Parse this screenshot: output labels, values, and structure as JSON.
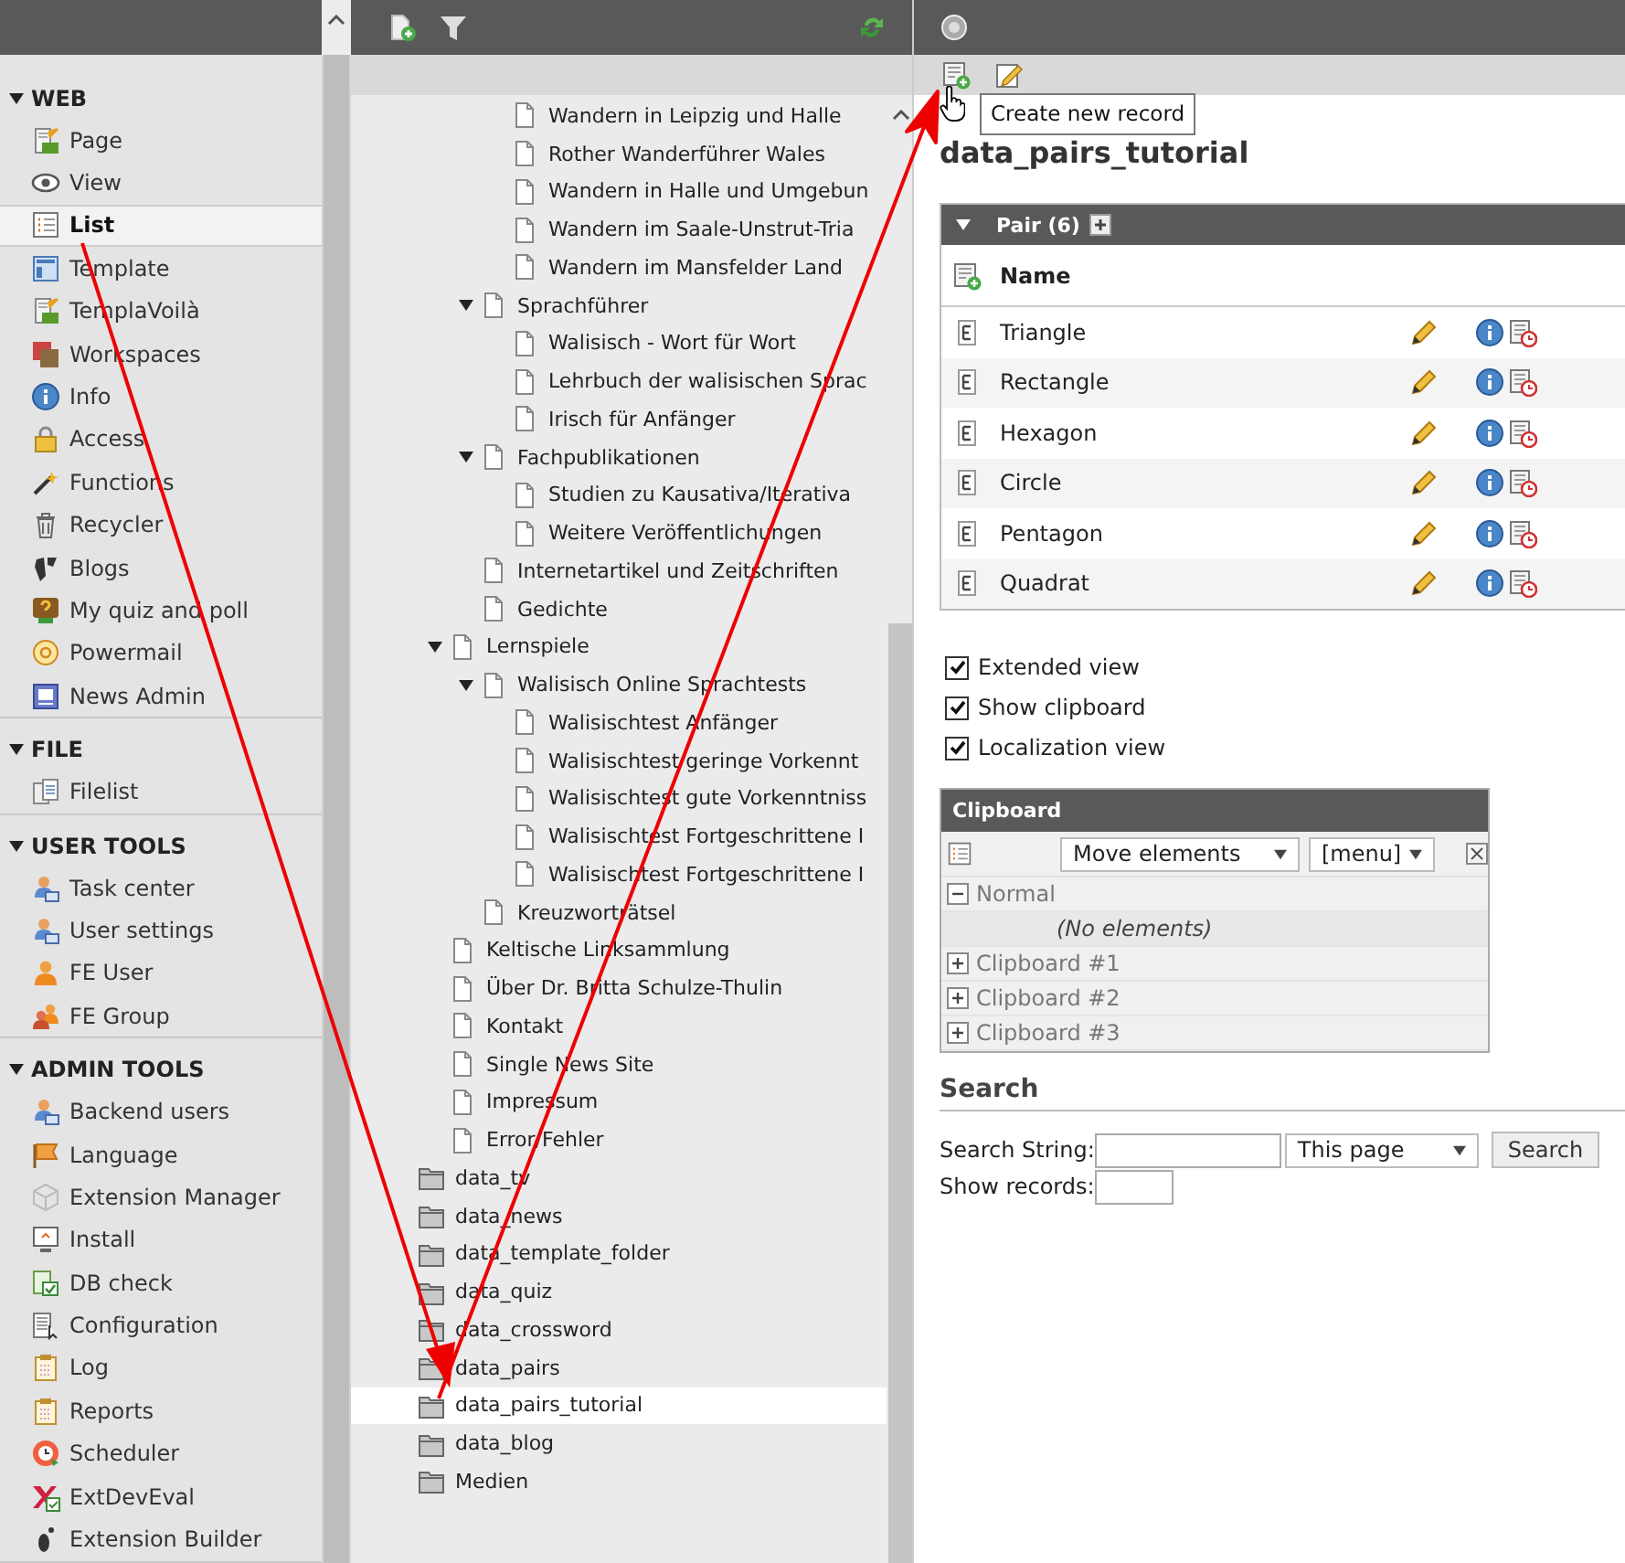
{
  "module_menu": {
    "groups": [
      {
        "title": "WEB",
        "expanded": true,
        "items": [
          {
            "label": "Page",
            "selected": false
          },
          {
            "label": "View",
            "selected": false
          },
          {
            "label": "List",
            "selected": true
          },
          {
            "label": "Template",
            "selected": false
          },
          {
            "label": "TemplaVoilà",
            "selected": false
          },
          {
            "label": "Workspaces",
            "selected": false
          },
          {
            "label": "Info",
            "selected": false
          },
          {
            "label": "Access",
            "selected": false
          },
          {
            "label": "Functions",
            "selected": false
          },
          {
            "label": "Recycler",
            "selected": false
          },
          {
            "label": "Blogs",
            "selected": false
          },
          {
            "label": "My quiz and poll",
            "selected": false
          },
          {
            "label": "Powermail",
            "selected": false
          },
          {
            "label": "News Admin",
            "selected": false
          }
        ]
      },
      {
        "title": "FILE",
        "expanded": true,
        "items": [
          {
            "label": "Filelist",
            "selected": false
          }
        ]
      },
      {
        "title": "USER TOOLS",
        "expanded": true,
        "items": [
          {
            "label": "Task center",
            "selected": false
          },
          {
            "label": "User settings",
            "selected": false
          },
          {
            "label": "FE User",
            "selected": false
          },
          {
            "label": "FE Group",
            "selected": false
          }
        ]
      },
      {
        "title": "ADMIN TOOLS",
        "expanded": true,
        "items": [
          {
            "label": "Backend users",
            "selected": false
          },
          {
            "label": "Language",
            "selected": false
          },
          {
            "label": "Extension Manager",
            "selected": false
          },
          {
            "label": "Install",
            "selected": false
          },
          {
            "label": "DB check",
            "selected": false
          },
          {
            "label": "Configuration",
            "selected": false
          },
          {
            "label": "Log",
            "selected": false
          },
          {
            "label": "Reports",
            "selected": false
          },
          {
            "label": "Scheduler",
            "selected": false
          },
          {
            "label": "ExtDevEval",
            "selected": false
          },
          {
            "label": "Extension Builder",
            "selected": false
          }
        ]
      }
    ]
  },
  "page_tree": {
    "items": [
      {
        "children": [
          {
            "children": [
              {
                "children": [
                  {
                    "label": "Wandern in Leipzig und Halle",
                    "kind": "page",
                    "expanded": false,
                    "selected": false
                  },
                  {
                    "label": "Rother Wanderführer Wales",
                    "kind": "page",
                    "expanded": false,
                    "selected": false
                  },
                  {
                    "label": "Wandern in Halle und Umgebun",
                    "kind": "page",
                    "expanded": false,
                    "selected": false
                  },
                  {
                    "label": "Wandern im Saale-Unstrut-Tria",
                    "kind": "page",
                    "expanded": false,
                    "selected": false
                  },
                  {
                    "label": "Wandern im Mansfelder Land",
                    "kind": "page",
                    "expanded": false,
                    "selected": false
                  }
                ]
              },
              {
                "label": "Sprachführer",
                "kind": "page",
                "expanded": true,
                "selected": false,
                "children": [
                  {
                    "label": "Walisisch - Wort für Wort",
                    "kind": "page",
                    "expanded": false,
                    "selected": false
                  },
                  {
                    "label": "Lehrbuch der walisischen Sprac",
                    "kind": "page",
                    "expanded": false,
                    "selected": false
                  },
                  {
                    "label": "Irisch für Anfänger",
                    "kind": "page",
                    "expanded": false,
                    "selected": false
                  }
                ]
              },
              {
                "label": "Fachpublikationen",
                "kind": "page",
                "expanded": true,
                "selected": false,
                "children": [
                  {
                    "label": "Studien zu Kausativa/Iterativa",
                    "kind": "page",
                    "expanded": false,
                    "selected": false
                  },
                  {
                    "label": "Weitere Veröffentlichungen",
                    "kind": "page",
                    "expanded": false,
                    "selected": false
                  }
                ]
              },
              {
                "label": "Internetartikel und Zeitschriften",
                "kind": "page",
                "expanded": false,
                "selected": false
              },
              {
                "label": "Gedichte",
                "kind": "page",
                "expanded": false,
                "selected": false
              }
            ]
          },
          {
            "label": "Lernspiele",
            "kind": "page",
            "expanded": true,
            "selected": false,
            "children": [
              {
                "label": "Walisisch Online Sprachtests",
                "kind": "page",
                "expanded": true,
                "selected": false,
                "children": [
                  {
                    "label": "Walisischtest Anfänger",
                    "kind": "page",
                    "expanded": false,
                    "selected": false
                  },
                  {
                    "label": "Walisischtest geringe Vorkennt",
                    "kind": "page",
                    "expanded": false,
                    "selected": false
                  },
                  {
                    "label": "Walisischtest gute Vorkenntniss",
                    "kind": "page",
                    "expanded": false,
                    "selected": false
                  },
                  {
                    "label": "Walisischtest Fortgeschrittene I",
                    "kind": "page",
                    "expanded": false,
                    "selected": false
                  },
                  {
                    "label": "Walisischtest Fortgeschrittene I",
                    "kind": "page",
                    "expanded": false,
                    "selected": false
                  }
                ]
              },
              {
                "label": "Kreuzworträtsel",
                "kind": "page",
                "expanded": false,
                "selected": false
              }
            ]
          },
          {
            "label": "Keltische Linksammlung",
            "kind": "page",
            "expanded": false,
            "selected": false
          },
          {
            "label": "Über Dr. Britta Schulze-Thulin",
            "kind": "page",
            "expanded": false,
            "selected": false
          },
          {
            "label": "Kontakt",
            "kind": "page",
            "expanded": false,
            "selected": false
          },
          {
            "label": "Single News Site",
            "kind": "page",
            "expanded": false,
            "selected": false
          },
          {
            "label": "Impressum",
            "kind": "page",
            "expanded": false,
            "selected": false
          },
          {
            "label": "Error/Fehler",
            "kind": "page",
            "expanded": false,
            "selected": false
          }
        ]
      },
      {
        "label": "data_tv",
        "kind": "folder",
        "expanded": false,
        "selected": false
      },
      {
        "label": "data_news",
        "kind": "folder",
        "expanded": false,
        "selected": false
      },
      {
        "label": "data_template_folder",
        "kind": "folder",
        "expanded": false,
        "selected": false
      },
      {
        "label": "data_quiz",
        "kind": "folder",
        "expanded": false,
        "selected": false
      },
      {
        "label": "data_crossword",
        "kind": "folder",
        "expanded": false,
        "selected": false
      },
      {
        "label": "data_pairs",
        "kind": "folder",
        "expanded": false,
        "selected": false
      },
      {
        "label": "data_pairs_tutorial",
        "kind": "folder",
        "expanded": false,
        "selected": true
      },
      {
        "label": "data_blog",
        "kind": "folder",
        "expanded": false,
        "selected": false
      },
      {
        "label": "Medien",
        "kind": "folder",
        "expanded": false,
        "selected": false
      }
    ]
  },
  "content": {
    "tooltip": "Create new record",
    "heading": "data_pairs_tutorial",
    "table": {
      "title": "Pair (6)",
      "expanded": true,
      "columns": [
        "Name"
      ],
      "rows": [
        {
          "name": "Triangle"
        },
        {
          "name": "Rectangle"
        },
        {
          "name": "Hexagon"
        },
        {
          "name": "Circle"
        },
        {
          "name": "Pentagon"
        },
        {
          "name": "Quadrat"
        }
      ]
    },
    "options": [
      {
        "label": "Extended view",
        "checked": true
      },
      {
        "label": "Show clipboard",
        "checked": true
      },
      {
        "label": "Localization view",
        "checked": true
      }
    ],
    "clipboard": {
      "title": "Clipboard",
      "mode": "Move elements",
      "menu": "[menu]",
      "pads": [
        {
          "label": "Normal",
          "expanded": true,
          "empty_text": "(No elements)"
        },
        {
          "label": "Clipboard #1",
          "expanded": false
        },
        {
          "label": "Clipboard #2",
          "expanded": false
        },
        {
          "label": "Clipboard #3",
          "expanded": false
        }
      ]
    },
    "search": {
      "title": "Search",
      "string_label": "Search String:",
      "scope": "This page",
      "button": "Search",
      "records_label": "Show records:"
    }
  }
}
